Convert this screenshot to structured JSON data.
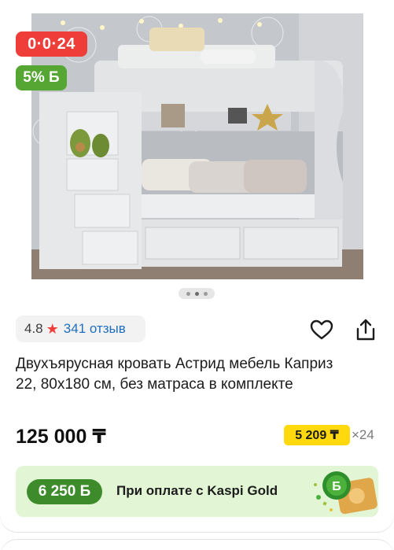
{
  "badges": {
    "timer": "0·0·24",
    "bonus": "5% Б"
  },
  "gallery": {
    "active_dot": 1,
    "dot_count": 3
  },
  "rating": {
    "score": "4.8",
    "star": "★",
    "reviews": "341 отзыв"
  },
  "actions": {
    "favorite_icon": "heart-icon",
    "share_icon": "share-icon"
  },
  "product": {
    "title": "Двухъярусная кровать Астрид мебель Каприз 22, 80х180 см, без матраса в комплекте",
    "price": "125 000 ₸",
    "installment_amount": "5 209 ₸",
    "installment_months": "×24"
  },
  "kaspi_gold": {
    "bonus": "6 250 Б",
    "label": "При оплате с Kaspi Gold"
  },
  "colors": {
    "timer_badge": "#ef3e3a",
    "bonus_badge": "#55a633",
    "installment_bg": "#ffd80d",
    "kaspi_bg": "#e2f5d5",
    "kaspi_pill": "#3d8b2b",
    "link": "#1f6fbe"
  }
}
